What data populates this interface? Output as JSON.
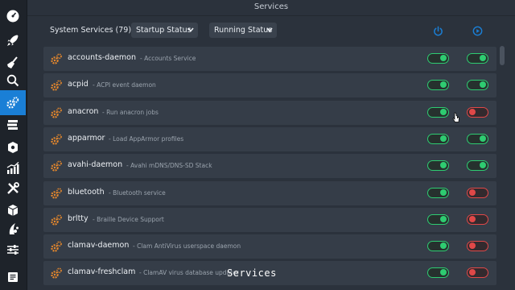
{
  "window": {
    "title": "Services"
  },
  "sidebar": {
    "items": [
      {
        "icon": "dashboard-gauge-icon"
      },
      {
        "icon": "rocket-icon"
      },
      {
        "icon": "broom-icon"
      },
      {
        "icon": "search-icon"
      },
      {
        "icon": "gears-icon",
        "active": true
      },
      {
        "icon": "stack-icon"
      },
      {
        "icon": "package-icon"
      },
      {
        "icon": "bar-chart-icon"
      },
      {
        "icon": "tools-icon"
      },
      {
        "icon": "box-icon"
      },
      {
        "icon": "paw-icon"
      },
      {
        "icon": "sliders-icon"
      },
      {
        "icon": "notes-icon"
      }
    ]
  },
  "toolbar": {
    "count_label": "System Services (79)",
    "startup_filter": "Startup Status",
    "running_filter": "Running Status",
    "startup_column_icon": "power-icon",
    "running_column_icon": "play-icon"
  },
  "services": [
    {
      "name": "accounts-daemon",
      "description": "- Accounts Service",
      "startup": true,
      "running": true
    },
    {
      "name": "acpid",
      "description": "- ACPI event daemon",
      "startup": true,
      "running": true
    },
    {
      "name": "anacron",
      "description": "- Run anacron jobs",
      "startup": true,
      "running": false
    },
    {
      "name": "apparmor",
      "description": "- Load AppArmor profiles",
      "startup": true,
      "running": true
    },
    {
      "name": "avahi-daemon",
      "description": "- Avahi mDNS/DNS-SD Stack",
      "startup": true,
      "running": true
    },
    {
      "name": "bluetooth",
      "description": "- Bluetooth service",
      "startup": true,
      "running": false
    },
    {
      "name": "brltty",
      "description": "- Braille Device Support",
      "startup": true,
      "running": false
    },
    {
      "name": "clamav-daemon",
      "description": "- Clam AntiVirus userspace daemon",
      "startup": true,
      "running": false
    },
    {
      "name": "clamav-freshclam",
      "description": "- ClamAV virus database updater",
      "startup": true,
      "running": false
    }
  ],
  "caption": "Services",
  "colors": {
    "accent": "#1a7fd6",
    "on": "#2ecc71",
    "off": "#e04848",
    "gear": "#e8892c"
  }
}
